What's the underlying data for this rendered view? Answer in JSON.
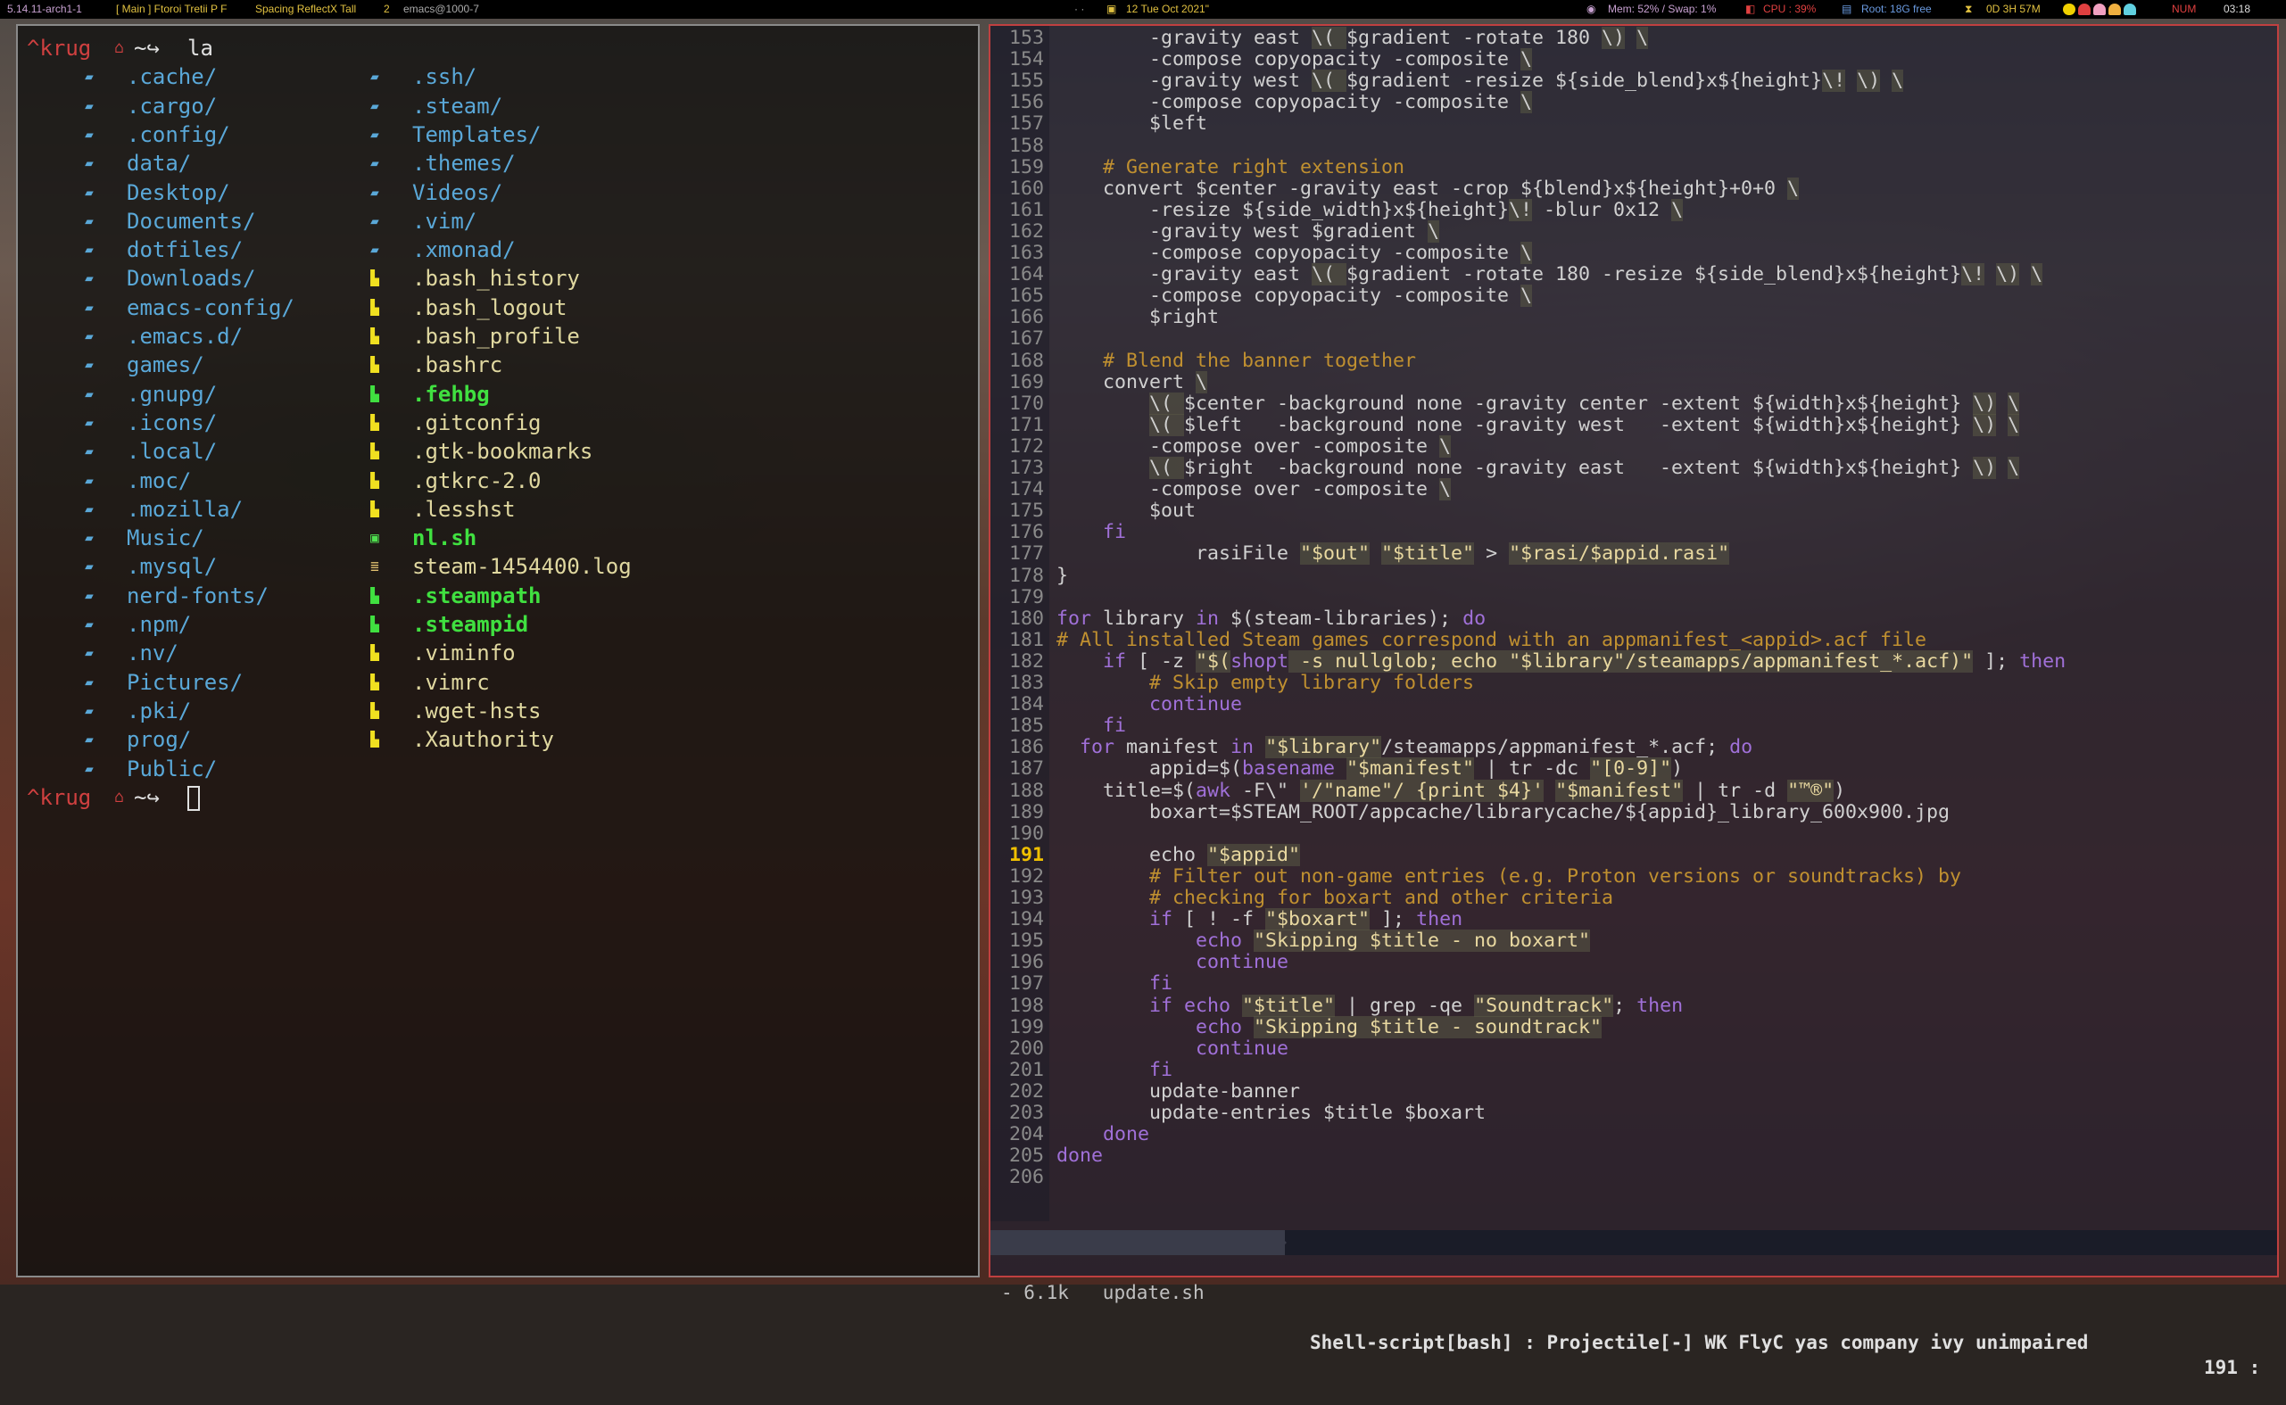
{
  "topbar": {
    "kernel": "5.14.11-arch1-1",
    "workspaces": "[ Main ] Ftoroi Tretii P F",
    "layout": "Spacing ReflectX Tall",
    "win_count": "2",
    "window_title": "emacs@1000-7",
    "separator": "· ·",
    "date": "12 Tue Oct 2021\"",
    "mem": "Mem: 52% / Swap: 1%",
    "cpu": "CPU : 39%",
    "disk": "Root: 18G free",
    "uptime": "0D 3H 57M",
    "numlock": "NUM",
    "time": "03:18",
    "colors": {
      "workspace": "#c7a0d0",
      "accent": "#e0c040",
      "alert": "#e04040",
      "disk": "#6a9ae0"
    }
  },
  "terminal": {
    "prompt_user": "^krug",
    "prompt_path": "~",
    "prompt_arrow": "↪",
    "command": "la",
    "left_column": [
      {
        "name": ".cache/",
        "type": "dir",
        "icon": "folder-icon"
      },
      {
        "name": ".cargo/",
        "type": "dir",
        "icon": "folder-icon"
      },
      {
        "name": ".config/",
        "type": "dir",
        "icon": "folder-icon"
      },
      {
        "name": "data/",
        "type": "dir",
        "icon": "folder-icon"
      },
      {
        "name": "Desktop/",
        "type": "dir",
        "icon": "folder-icon"
      },
      {
        "name": "Documents/",
        "type": "dir",
        "icon": "folder-icon"
      },
      {
        "name": "dotfiles/",
        "type": "dir",
        "icon": "folder-icon"
      },
      {
        "name": "Downloads/",
        "type": "dir",
        "icon": "folder-icon"
      },
      {
        "name": "emacs-config/",
        "type": "dir",
        "icon": "folder-icon"
      },
      {
        "name": ".emacs.d/",
        "type": "dir",
        "icon": "folder-icon"
      },
      {
        "name": "games/",
        "type": "dir",
        "icon": "folder-icon"
      },
      {
        "name": ".gnupg/",
        "type": "dir",
        "icon": "folder-icon"
      },
      {
        "name": ".icons/",
        "type": "dir",
        "icon": "folder-icon"
      },
      {
        "name": ".local/",
        "type": "dir",
        "icon": "folder-icon"
      },
      {
        "name": ".moc/",
        "type": "dir",
        "icon": "folder-icon"
      },
      {
        "name": ".mozilla/",
        "type": "dir",
        "icon": "folder-icon"
      },
      {
        "name": "Music/",
        "type": "dir",
        "icon": "folder-icon"
      },
      {
        "name": ".mysql/",
        "type": "dir",
        "icon": "folder-icon"
      },
      {
        "name": "nerd-fonts/",
        "type": "dir",
        "icon": "folder-icon"
      },
      {
        "name": ".npm/",
        "type": "dir",
        "icon": "folder-icon"
      },
      {
        "name": ".nv/",
        "type": "dir",
        "icon": "folder-icon"
      },
      {
        "name": "Pictures/",
        "type": "dir",
        "icon": "folder-icon"
      },
      {
        "name": ".pki/",
        "type": "dir",
        "icon": "folder-icon"
      },
      {
        "name": "prog/",
        "type": "dir",
        "icon": "folder-icon"
      },
      {
        "name": "Public/",
        "type": "dir",
        "icon": "folder-icon"
      }
    ],
    "right_column": [
      {
        "name": ".ssh/",
        "type": "dir",
        "icon": "folder-icon"
      },
      {
        "name": ".steam/",
        "type": "dir",
        "icon": "folder-icon"
      },
      {
        "name": "Templates/",
        "type": "dir",
        "icon": "folder-icon"
      },
      {
        "name": ".themes/",
        "type": "dir",
        "icon": "folder-icon"
      },
      {
        "name": "Videos/",
        "type": "dir",
        "icon": "folder-icon"
      },
      {
        "name": ".vim/",
        "type": "dir",
        "icon": "folder-icon"
      },
      {
        "name": ".xmonad/",
        "type": "dir",
        "icon": "folder-icon"
      },
      {
        "name": ".bash_history",
        "type": "file",
        "icon": "file-icon"
      },
      {
        "name": ".bash_logout",
        "type": "file",
        "icon": "file-icon"
      },
      {
        "name": ".bash_profile",
        "type": "file",
        "icon": "file-icon"
      },
      {
        "name": ".bashrc",
        "type": "file",
        "icon": "file-icon"
      },
      {
        "name": ".fehbg",
        "type": "exe",
        "icon": "exec-file-icon"
      },
      {
        "name": ".gitconfig",
        "type": "file",
        "icon": "file-icon"
      },
      {
        "name": ".gtk-bookmarks",
        "type": "file",
        "icon": "file-icon"
      },
      {
        "name": ".gtkrc-2.0",
        "type": "file",
        "icon": "file-icon"
      },
      {
        "name": ".lesshst",
        "type": "file",
        "icon": "file-icon"
      },
      {
        "name": "nl.sh",
        "type": "exe",
        "icon": "script-icon"
      },
      {
        "name": "steam-1454400.log",
        "type": "file",
        "icon": "log-icon"
      },
      {
        "name": ".steampath",
        "type": "exe",
        "icon": "exec-file-icon"
      },
      {
        "name": ".steampid",
        "type": "exe",
        "icon": "exec-file-icon"
      },
      {
        "name": ".viminfo",
        "type": "file",
        "icon": "file-icon"
      },
      {
        "name": ".vimrc",
        "type": "file",
        "icon": "file-icon"
      },
      {
        "name": ".wget-hsts",
        "type": "file",
        "icon": "file-icon"
      },
      {
        "name": ".Xauthority",
        "type": "file",
        "icon": "file-icon"
      }
    ]
  },
  "editor": {
    "current_line": 191,
    "lines": [
      {
        "n": 153,
        "s": [
          [
            "n",
            "        -gravity east "
          ],
          [
            "b",
            "\\( "
          ],
          [
            "n",
            "$gradient -rotate 180 "
          ],
          [
            "b",
            "\\)"
          ],
          [
            "n",
            " "
          ],
          [
            "b",
            "\\"
          ]
        ]
      },
      {
        "n": 154,
        "s": [
          [
            "n",
            "        -compose copyopacity -composite "
          ],
          [
            "b",
            "\\"
          ]
        ]
      },
      {
        "n": 155,
        "s": [
          [
            "n",
            "        -gravity west "
          ],
          [
            "b",
            "\\( "
          ],
          [
            "n",
            "$gradient -resize ${side_blend}x${height}"
          ],
          [
            "b",
            "\\!"
          ],
          [
            "n",
            " "
          ],
          [
            "b",
            "\\)"
          ],
          [
            "n",
            " "
          ],
          [
            "b",
            "\\"
          ]
        ]
      },
      {
        "n": 156,
        "s": [
          [
            "n",
            "        -compose copyopacity -composite "
          ],
          [
            "b",
            "\\"
          ]
        ]
      },
      {
        "n": 157,
        "s": [
          [
            "n",
            "        $left"
          ]
        ]
      },
      {
        "n": 158,
        "s": []
      },
      {
        "n": 159,
        "s": [
          [
            "c",
            "    # Generate right extension"
          ]
        ]
      },
      {
        "n": 160,
        "s": [
          [
            "n",
            "    convert $center -gravity east -crop ${blend}x${height}+0+0 "
          ],
          [
            "b",
            "\\"
          ]
        ]
      },
      {
        "n": 161,
        "s": [
          [
            "n",
            "        -resize ${side_width}x${height}"
          ],
          [
            "b",
            "\\!"
          ],
          [
            "n",
            " -blur 0x12 "
          ],
          [
            "b",
            "\\"
          ]
        ]
      },
      {
        "n": 162,
        "s": [
          [
            "n",
            "        -gravity west $gradient "
          ],
          [
            "b",
            "\\"
          ]
        ]
      },
      {
        "n": 163,
        "s": [
          [
            "n",
            "        -compose copyopacity -composite "
          ],
          [
            "b",
            "\\"
          ]
        ]
      },
      {
        "n": 164,
        "s": [
          [
            "n",
            "        -gravity east "
          ],
          [
            "b",
            "\\( "
          ],
          [
            "n",
            "$gradient -rotate 180 -resize ${side_blend}x${height}"
          ],
          [
            "b",
            "\\!"
          ],
          [
            "n",
            " "
          ],
          [
            "b",
            "\\)"
          ],
          [
            "n",
            " "
          ],
          [
            "b",
            "\\"
          ]
        ]
      },
      {
        "n": 165,
        "s": [
          [
            "n",
            "        -compose copyopacity -composite "
          ],
          [
            "b",
            "\\"
          ]
        ]
      },
      {
        "n": 166,
        "s": [
          [
            "n",
            "        $right"
          ]
        ]
      },
      {
        "n": 167,
        "s": []
      },
      {
        "n": 168,
        "s": [
          [
            "c",
            "    # Blend the banner together"
          ]
        ]
      },
      {
        "n": 169,
        "s": [
          [
            "n",
            "    convert "
          ],
          [
            "b",
            "\\"
          ]
        ]
      },
      {
        "n": 170,
        "s": [
          [
            "n",
            "        "
          ],
          [
            "b",
            "\\( "
          ],
          [
            "n",
            "$center -background none -gravity center -extent ${width}x${height} "
          ],
          [
            "b",
            "\\)"
          ],
          [
            "n",
            " "
          ],
          [
            "b",
            "\\"
          ]
        ]
      },
      {
        "n": 171,
        "s": [
          [
            "n",
            "        "
          ],
          [
            "b",
            "\\( "
          ],
          [
            "n",
            "$left   -background none -gravity west   -extent ${width}x${height} "
          ],
          [
            "b",
            "\\)"
          ],
          [
            "n",
            " "
          ],
          [
            "b",
            "\\"
          ]
        ]
      },
      {
        "n": 172,
        "s": [
          [
            "n",
            "        -compose over -composite "
          ],
          [
            "b",
            "\\"
          ]
        ]
      },
      {
        "n": 173,
        "s": [
          [
            "n",
            "        "
          ],
          [
            "b",
            "\\( "
          ],
          [
            "n",
            "$right  -background none -gravity east   -extent ${width}x${height} "
          ],
          [
            "b",
            "\\)"
          ],
          [
            "n",
            " "
          ],
          [
            "b",
            "\\"
          ]
        ]
      },
      {
        "n": 174,
        "s": [
          [
            "n",
            "        -compose over -composite "
          ],
          [
            "b",
            "\\"
          ]
        ]
      },
      {
        "n": 175,
        "s": [
          [
            "n",
            "        $out"
          ]
        ]
      },
      {
        "n": 176,
        "s": [
          [
            "k",
            "    fi"
          ]
        ]
      },
      {
        "n": 177,
        "s": [
          [
            "n",
            "            rasiFile "
          ],
          [
            "q",
            "\"$out\""
          ],
          [
            "n",
            " "
          ],
          [
            "q",
            "\"$title\""
          ],
          [
            "n",
            " > "
          ],
          [
            "q",
            "\"$rasi/$appid.rasi\""
          ]
        ]
      },
      {
        "n": 178,
        "s": [
          [
            "n",
            "}"
          ]
        ]
      },
      {
        "n": 179,
        "s": []
      },
      {
        "n": 180,
        "s": [
          [
            "k",
            "for"
          ],
          [
            "n",
            " library "
          ],
          [
            "k",
            "in"
          ],
          [
            "n",
            " $(steam-libraries); "
          ],
          [
            "k",
            "do"
          ]
        ]
      },
      {
        "n": 181,
        "s": [
          [
            "c",
            "# All installed Steam games correspond with an appmanifest_<appid>.acf file"
          ]
        ]
      },
      {
        "n": 182,
        "s": [
          [
            "n",
            "    "
          ],
          [
            "k",
            "if"
          ],
          [
            "n",
            " [ -z "
          ],
          [
            "q",
            "\"$("
          ],
          [
            "k",
            "shopt"
          ],
          [
            "q",
            " -s nullglob; echo \"$library\"/steamapps/appmanifest_*.acf)\""
          ],
          [
            "n",
            " ]; "
          ],
          [
            "k",
            "then"
          ]
        ]
      },
      {
        "n": 183,
        "s": [
          [
            "c",
            "        # Skip empty library folders"
          ]
        ]
      },
      {
        "n": 184,
        "s": [
          [
            "k",
            "        continue"
          ]
        ]
      },
      {
        "n": 185,
        "s": [
          [
            "k",
            "    fi"
          ]
        ]
      },
      {
        "n": 186,
        "s": [
          [
            "k",
            "  for"
          ],
          [
            "n",
            " manifest "
          ],
          [
            "k",
            "in"
          ],
          [
            "n",
            " "
          ],
          [
            "q",
            "\"$library\""
          ],
          [
            "n",
            "/steamapps/appmanifest_*.acf; "
          ],
          [
            "k",
            "do"
          ]
        ]
      },
      {
        "n": 187,
        "s": [
          [
            "n",
            "        appid=$("
          ],
          [
            "k",
            "basename"
          ],
          [
            "n",
            " "
          ],
          [
            "q",
            "\"$manifest\""
          ],
          [
            "n",
            " | tr -dc "
          ],
          [
            "q",
            "\"[0-9]\""
          ],
          [
            "n",
            ")"
          ]
        ]
      },
      {
        "n": 188,
        "s": [
          [
            "n",
            "    title=$("
          ],
          [
            "k",
            "awk"
          ],
          [
            "n",
            " -F\\\" "
          ],
          [
            "q",
            "'/\"name\"/ {print $4}'"
          ],
          [
            "n",
            " "
          ],
          [
            "q",
            "\"$manifest\""
          ],
          [
            "n",
            " | tr -d "
          ],
          [
            "q",
            "\"™®\""
          ],
          [
            "n",
            ")"
          ]
        ]
      },
      {
        "n": 189,
        "s": [
          [
            "n",
            "        boxart=$STEAM_ROOT/appcache/librarycache/${appid}_library_600x900.jpg"
          ]
        ]
      },
      {
        "n": 190,
        "s": []
      },
      {
        "n": 191,
        "s": [
          [
            "n",
            "        echo "
          ],
          [
            "q",
            "\"$appid\""
          ]
        ]
      },
      {
        "n": 192,
        "s": [
          [
            "c",
            "        # Filter out non-game entries (e.g. Proton versions or soundtracks) by"
          ]
        ]
      },
      {
        "n": 193,
        "s": [
          [
            "c",
            "        # checking for boxart and other criteria"
          ]
        ]
      },
      {
        "n": 194,
        "s": [
          [
            "k",
            "        if"
          ],
          [
            "n",
            " [ ! -f "
          ],
          [
            "q",
            "\"$boxart\""
          ],
          [
            "n",
            " ]; "
          ],
          [
            "k",
            "then"
          ]
        ]
      },
      {
        "n": 195,
        "s": [
          [
            "k",
            "            echo"
          ],
          [
            "n",
            " "
          ],
          [
            "q",
            "\"Skipping $title - no boxart\""
          ]
        ]
      },
      {
        "n": 196,
        "s": [
          [
            "k",
            "            continue"
          ]
        ]
      },
      {
        "n": 197,
        "s": [
          [
            "k",
            "        fi"
          ]
        ]
      },
      {
        "n": 198,
        "s": [
          [
            "k",
            "        if echo"
          ],
          [
            "n",
            " "
          ],
          [
            "q",
            "\"$title\""
          ],
          [
            "n",
            " | grep -qe "
          ],
          [
            "q",
            "\"Soundtrack\""
          ],
          [
            "n",
            "; "
          ],
          [
            "k",
            "then"
          ]
        ]
      },
      {
        "n": 199,
        "s": [
          [
            "k",
            "            echo"
          ],
          [
            "n",
            " "
          ],
          [
            "q",
            "\"Skipping $title - soundtrack\""
          ]
        ]
      },
      {
        "n": 200,
        "s": [
          [
            "k",
            "            continue"
          ]
        ]
      },
      {
        "n": 201,
        "s": [
          [
            "k",
            "        fi"
          ]
        ]
      },
      {
        "n": 202,
        "s": [
          [
            "n",
            "        update-banner"
          ]
        ]
      },
      {
        "n": 203,
        "s": [
          [
            "n",
            "        update-entries $title $boxart"
          ]
        ]
      },
      {
        "n": 204,
        "s": [
          [
            "k",
            "    done"
          ]
        ]
      },
      {
        "n": 205,
        "s": [
          [
            "k",
            "done"
          ]
        ]
      },
      {
        "n": 206,
        "s": []
      }
    ],
    "modeline": {
      "size": "- 6.1k",
      "buffer": "update.sh",
      "modes": "Shell-script[bash] : Projectile[-] WK FlyC yas company ivy unimpaired",
      "line": "191 :"
    }
  }
}
